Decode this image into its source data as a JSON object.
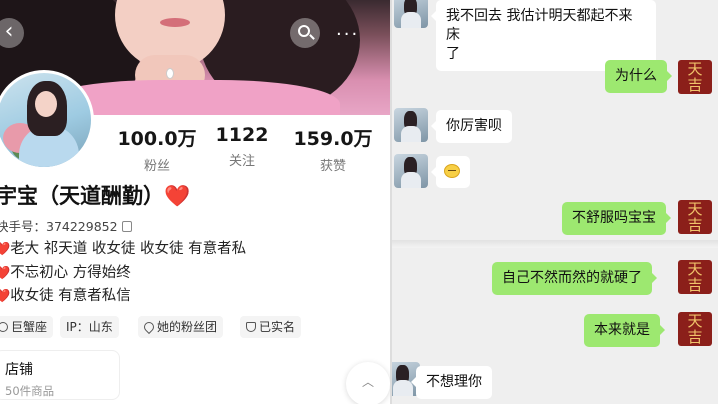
{
  "profile": {
    "stats": [
      {
        "value": "100.0万",
        "label": "粉丝"
      },
      {
        "value": "1122",
        "label": "关注"
      },
      {
        "value": "159.0万",
        "label": "获赞"
      }
    ],
    "nickname": "宇宝（天道酬勤）",
    "nickname_emoji": "❤️",
    "uid_label": "快手号：374229852",
    "bio": [
      {
        "heart": "❤️",
        "text": "老大 祁天道  收女徒 收女徒 有意者私"
      },
      {
        "heart": "❤️",
        "text": "不忘初心 方得始终"
      },
      {
        "heart": "❤️",
        "text": "收女徒 有意者私信"
      }
    ],
    "tags": [
      {
        "icon": "zodiac-icon",
        "label": "巨蟹座"
      },
      {
        "icon": "",
        "label": "IP：山东"
      },
      {
        "icon": "fans-group-icon",
        "label": "她的粉丝团"
      },
      {
        "icon": "verified-shield-icon",
        "label": "已实名"
      }
    ],
    "shop": {
      "title": "店铺",
      "subtitle": "50件商品"
    },
    "nav": {
      "back": "‹",
      "more": "···",
      "scroll_top": "︿"
    }
  },
  "chat": {
    "self_avatar_text": [
      "天",
      "吉"
    ],
    "messages": [
      {
        "side": "in",
        "text": "我不回去 我估计明天都起不来床"
      },
      {
        "side": "in",
        "text": "了"
      },
      {
        "side": "out",
        "text": "为什么"
      },
      {
        "side": "in",
        "text": "你厉害呗"
      },
      {
        "side": "in",
        "text": "",
        "emoji": "awkward-face-emoji"
      },
      {
        "side": "out",
        "text": "不舒服吗宝宝"
      },
      {
        "side": "out",
        "text": "自己不然而然的就硬了"
      },
      {
        "side": "out",
        "text": "本来就是"
      },
      {
        "side": "in",
        "text": "不想理你"
      }
    ]
  },
  "colors": {
    "outgoing_bubble": "#9de870",
    "incoming_bubble": "#ffffff",
    "heart": "#e0272a",
    "self_avatar_bg": "#8b1f1a",
    "self_avatar_text": "#f0c36a"
  }
}
